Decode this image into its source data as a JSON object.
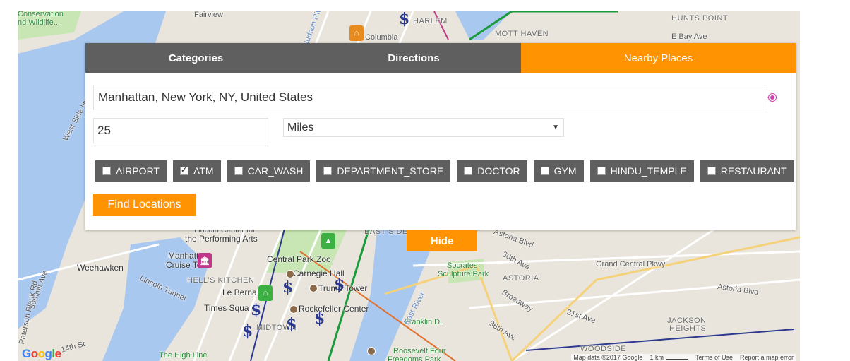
{
  "tabs": [
    {
      "label": "Categories"
    },
    {
      "label": "Directions"
    },
    {
      "label": "Nearby Places"
    }
  ],
  "search": {
    "location_value": "Manhattan, New York, NY, United States",
    "radius_value": "25",
    "unit_selected": "Miles"
  },
  "categories": [
    {
      "label": "AIRPORT",
      "checked": false
    },
    {
      "label": "ATM",
      "checked": true
    },
    {
      "label": "CAR_WASH",
      "checked": false
    },
    {
      "label": "DEPARTMENT_STORE",
      "checked": false
    },
    {
      "label": "DOCTOR",
      "checked": false
    },
    {
      "label": "GYM",
      "checked": false
    },
    {
      "label": "HINDU_TEMPLE",
      "checked": false
    },
    {
      "label": "RESTAURANT",
      "checked": false
    }
  ],
  "buttons": {
    "find_label": "Find Locations",
    "hide_label": "Hide"
  },
  "map": {
    "labels": {
      "conservation": "Conservation",
      "wildlife": "nd Wildlife...",
      "fairview": "Fairview",
      "harlem": "HARLEM",
      "columbia": "Columbia",
      "mott_haven": "MOTT HAVEN",
      "hunts_point": "HUNTS POINT",
      "e_bay_ave": "E Bay Ave",
      "west_side_hwy": "West Side Hwy",
      "weehawken": "Weehawken",
      "manhattan_cruise": "Manhattan",
      "cruise_term": "Cruise Term",
      "lincoln_tunnel": "Lincoln Tunnel",
      "hells_kitchen": "HELL'S KITCHEN",
      "lincoln_center": "Lincoln Center for",
      "performing_arts": "the Performing Arts",
      "central_park_zoo": "Central Park Zoo",
      "carnegie_hall": "Carnegie Hall",
      "le_bernardin": "Le Berna",
      "trump_tower": "Trump Tower",
      "times_square": "Times Squa",
      "rockefeller": "Rockefeller Center",
      "midtown": "MIDTOWN",
      "east_side": "EAST SIDE",
      "socrates": "Socrates",
      "sculpture_park": "Sculpture Park",
      "astoria": "ASTORIA",
      "astoria_blvd": "Astoria Blvd",
      "astoria_blvd2": "Astoria Blvd",
      "grand_central": "Grand Central Pkwy",
      "jackson_heights": "JACKSON",
      "jackson_heights2": "HEIGHTS",
      "woodside": "WOODSIDE",
      "franklin": "Franklin D.",
      "roosevelt": "Roosevelt Four",
      "freedoms": "Freedoms Park",
      "high_line": "The High Line",
      "summit_ave": "Summit Ave",
      "paterson": "Paterson Plank Rd",
      "fourteenth": "14th St",
      "hudson_river": "Hudson River",
      "east_river": "East River",
      "thirtieth_ave": "30th Ave",
      "broadway": "Broadway",
      "thirtysixth": "36th Ave",
      "thirtyfirst": "31st Ave"
    },
    "footer": {
      "map_data": "Map data ©2017 Google",
      "scale": "1 km",
      "terms": "Terms of Use",
      "report": "Report a map error"
    },
    "google_letters": [
      "G",
      "o",
      "o",
      "g",
      "l",
      "e"
    ]
  },
  "colors": {
    "accent_orange": "#ff9302",
    "tab_gray": "#5f5f5f",
    "map_bg": "#e9e5dc",
    "water": "#a9c8f0",
    "park": "#c8e6b4"
  }
}
